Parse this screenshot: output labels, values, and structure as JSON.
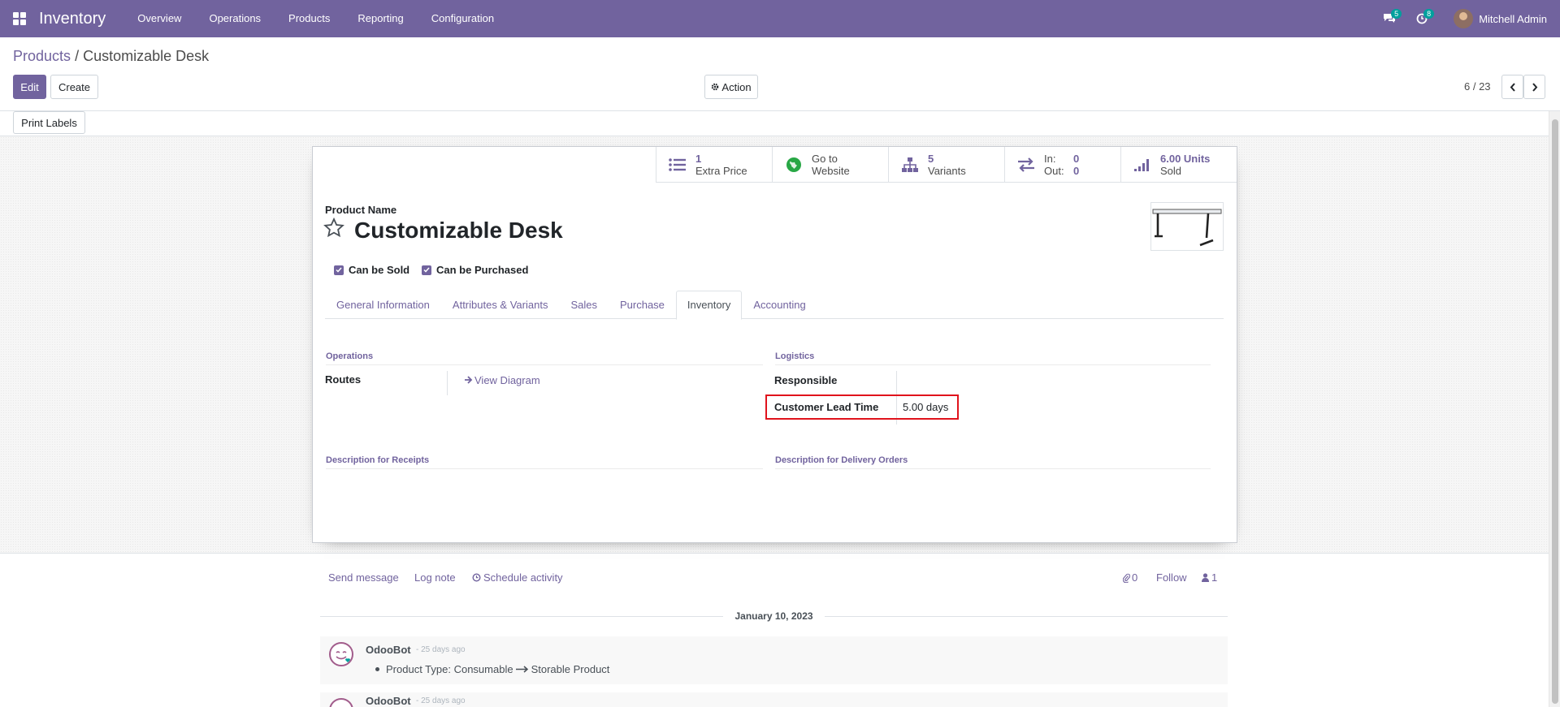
{
  "navbar": {
    "app_name": "Inventory",
    "menu": [
      "Overview",
      "Operations",
      "Products",
      "Reporting",
      "Configuration"
    ],
    "messages_count": "5",
    "activities_count": "8",
    "user_name": "Mitchell Admin"
  },
  "breadcrumb": {
    "parent": "Products",
    "separator": "/",
    "current": "Customizable Desk"
  },
  "buttons": {
    "edit": "Edit",
    "create": "Create",
    "action": "Action",
    "print_labels": "Print Labels"
  },
  "pager": {
    "value": "6 / 23"
  },
  "smart_buttons": {
    "extra_price": {
      "value": "1",
      "label": "Extra Price"
    },
    "website": {
      "line1": "Go to",
      "line2": "Website"
    },
    "variants": {
      "value": "5",
      "label": "Variants"
    },
    "inout": {
      "in_label": "In:",
      "in_value": "0",
      "out_label": "Out:",
      "out_value": "0"
    },
    "sold": {
      "value": "6.00 Units",
      "label": "Sold"
    }
  },
  "product": {
    "name_label": "Product Name",
    "name": "Customizable Desk",
    "can_be_sold": "Can be Sold",
    "can_be_purchased": "Can be Purchased"
  },
  "tabs": [
    "General Information",
    "Attributes & Variants",
    "Sales",
    "Purchase",
    "Inventory",
    "Accounting"
  ],
  "inventory_tab": {
    "operations_title": "Operations",
    "routes_label": "Routes",
    "view_diagram": "View Diagram",
    "logistics_title": "Logistics",
    "responsible_label": "Responsible",
    "lead_time_label": "Customer Lead Time",
    "lead_time_value": "5.00 days",
    "desc_receipts": "Description for Receipts",
    "desc_delivery": "Description for Delivery Orders"
  },
  "chatter": {
    "send_message": "Send message",
    "log_note": "Log note",
    "schedule_activity": "Schedule activity",
    "attachments": "0",
    "follow": "Follow",
    "followers": "1",
    "date": "January 10, 2023",
    "messages": [
      {
        "author": "OdooBot",
        "time": "- 25 days ago",
        "old": "Product Type: Consumable",
        "new": "Storable Product"
      },
      {
        "author": "OdooBot",
        "time": "- 25 days ago"
      }
    ]
  },
  "colors": {
    "brand": "#71639e",
    "highlight": "#e0131c",
    "badge": "#00a09d"
  }
}
